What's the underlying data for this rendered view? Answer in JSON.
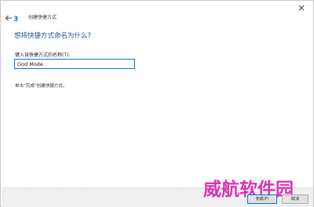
{
  "window": {
    "title": "创建快捷方式",
    "app_icon_glyph": "3"
  },
  "icons": {
    "back": "arrow-left-icon",
    "close": "close-icon"
  },
  "main": {
    "heading": "想将快捷方式命名为什么?",
    "field_label": "键入该快捷方式的名称(T):",
    "name_value": "God Mode",
    "hint": "单击\"完成\"创建快捷方式。"
  },
  "footer": {
    "finish_label": "完成(F)",
    "cancel_label": "取消"
  },
  "watermark": "威航软件园",
  "colors": {
    "heading": "#1f4e9b",
    "input_border": "#1a73c9",
    "watermark": "#d81faa",
    "footer_bg": "#f0f0f0"
  }
}
